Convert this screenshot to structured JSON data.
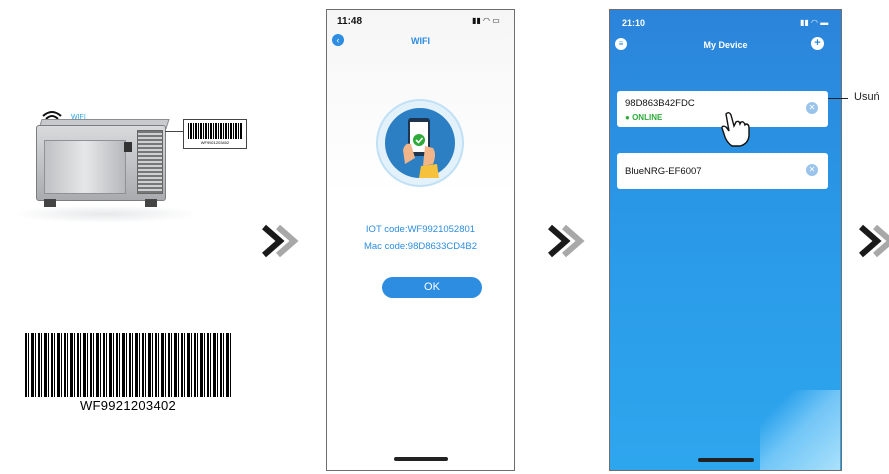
{
  "left_panel": {
    "wifi_label": "WIFI",
    "small_barcode_text": "WF9921203402",
    "big_barcode_text": "WF9921203402"
  },
  "phone1": {
    "time": "11:48",
    "title": "WIFI",
    "iot_code": "IOT code:WF9921052801",
    "mac_code": "Mac code:98D8633CD4B2",
    "ok_button": "OK"
  },
  "phone2": {
    "time": "21:10",
    "title": "My Device",
    "devices": [
      {
        "name": "98D863B42FDC",
        "status": "ONLINE"
      },
      {
        "name": "BlueNRG-EF6007",
        "status": ""
      }
    ]
  },
  "annotation": {
    "usun": "Usuń"
  },
  "colors": {
    "accent": "#2c8de1",
    "online": "#2daa3a",
    "chevron": "#1a1a1a",
    "chevron_light": "#a8a8a8"
  }
}
